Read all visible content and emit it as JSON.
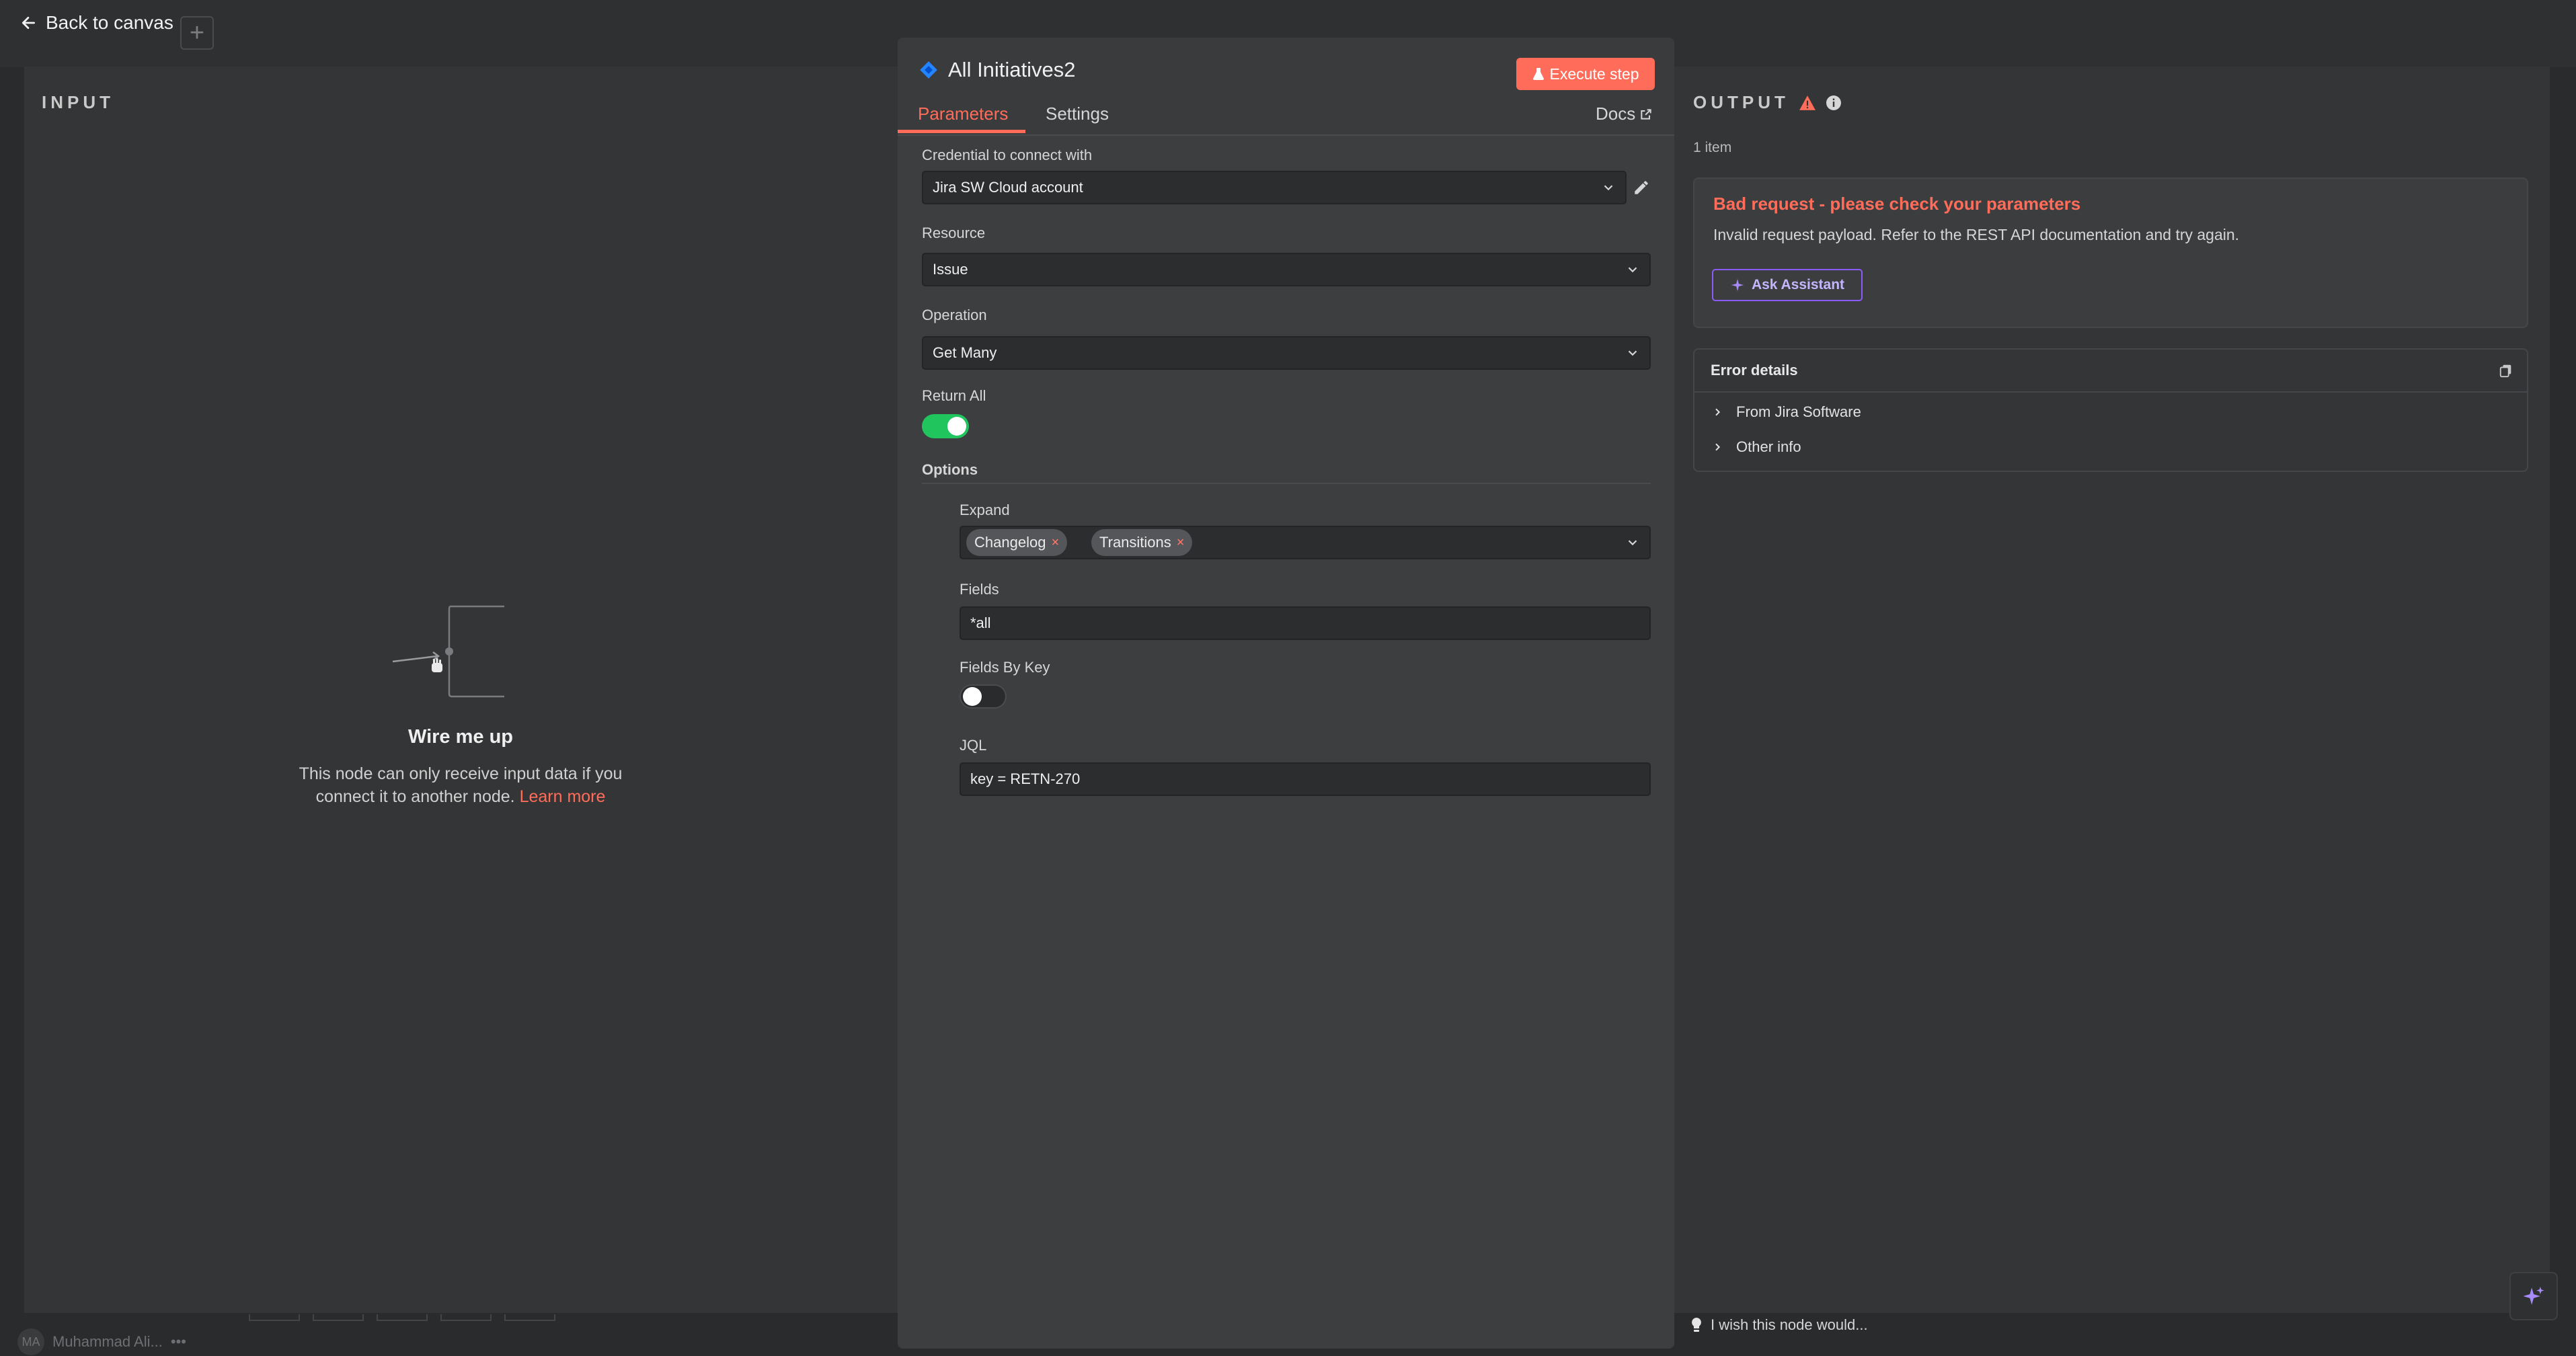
{
  "canvas": {
    "back_label": "Back to canvas",
    "add_label": "+",
    "user_initials": "MA",
    "user_name": "Muhammad Ali...",
    "user_more": "•••"
  },
  "input": {
    "label": "INPUT",
    "wire_title": "Wire me up",
    "wire_desc": "This node can only receive input data if you connect it to another node.",
    "learn_more": "Learn more"
  },
  "node": {
    "title": "All Initiatives2",
    "execute_label": "Execute step",
    "tabs": {
      "parameters": "Parameters",
      "settings": "Settings"
    },
    "docs_label": "Docs"
  },
  "params": {
    "credential_label": "Credential to connect with",
    "credential_value": "Jira SW Cloud account",
    "resource_label": "Resource",
    "resource_value": "Issue",
    "operation_label": "Operation",
    "operation_value": "Get Many",
    "return_all_label": "Return All",
    "return_all": true,
    "options_label": "Options",
    "expand_label": "Expand",
    "expand_chips": [
      "Changelog",
      "Transitions"
    ],
    "fields_label": "Fields",
    "fields_value": "*all",
    "fields_by_key_label": "Fields By Key",
    "fields_by_key": false,
    "jql_label": "JQL",
    "jql_value": "key = RETN-270"
  },
  "output": {
    "label": "OUTPUT",
    "items_count": "1 item",
    "error_title": "Bad request - please check your parameters",
    "error_desc": "Invalid request payload. Refer to the REST API documentation and try again.",
    "ask_assistant": "Ask Assistant",
    "details_title": "Error details",
    "details_items": [
      "From Jira Software",
      "Other info"
    ],
    "wish_text": "I wish this node would..."
  },
  "colors": {
    "accent": "#ff6d5a",
    "toggle_on": "#20c55e",
    "assistant": "#8b5cf6",
    "jira_blue": "#2684ff"
  }
}
